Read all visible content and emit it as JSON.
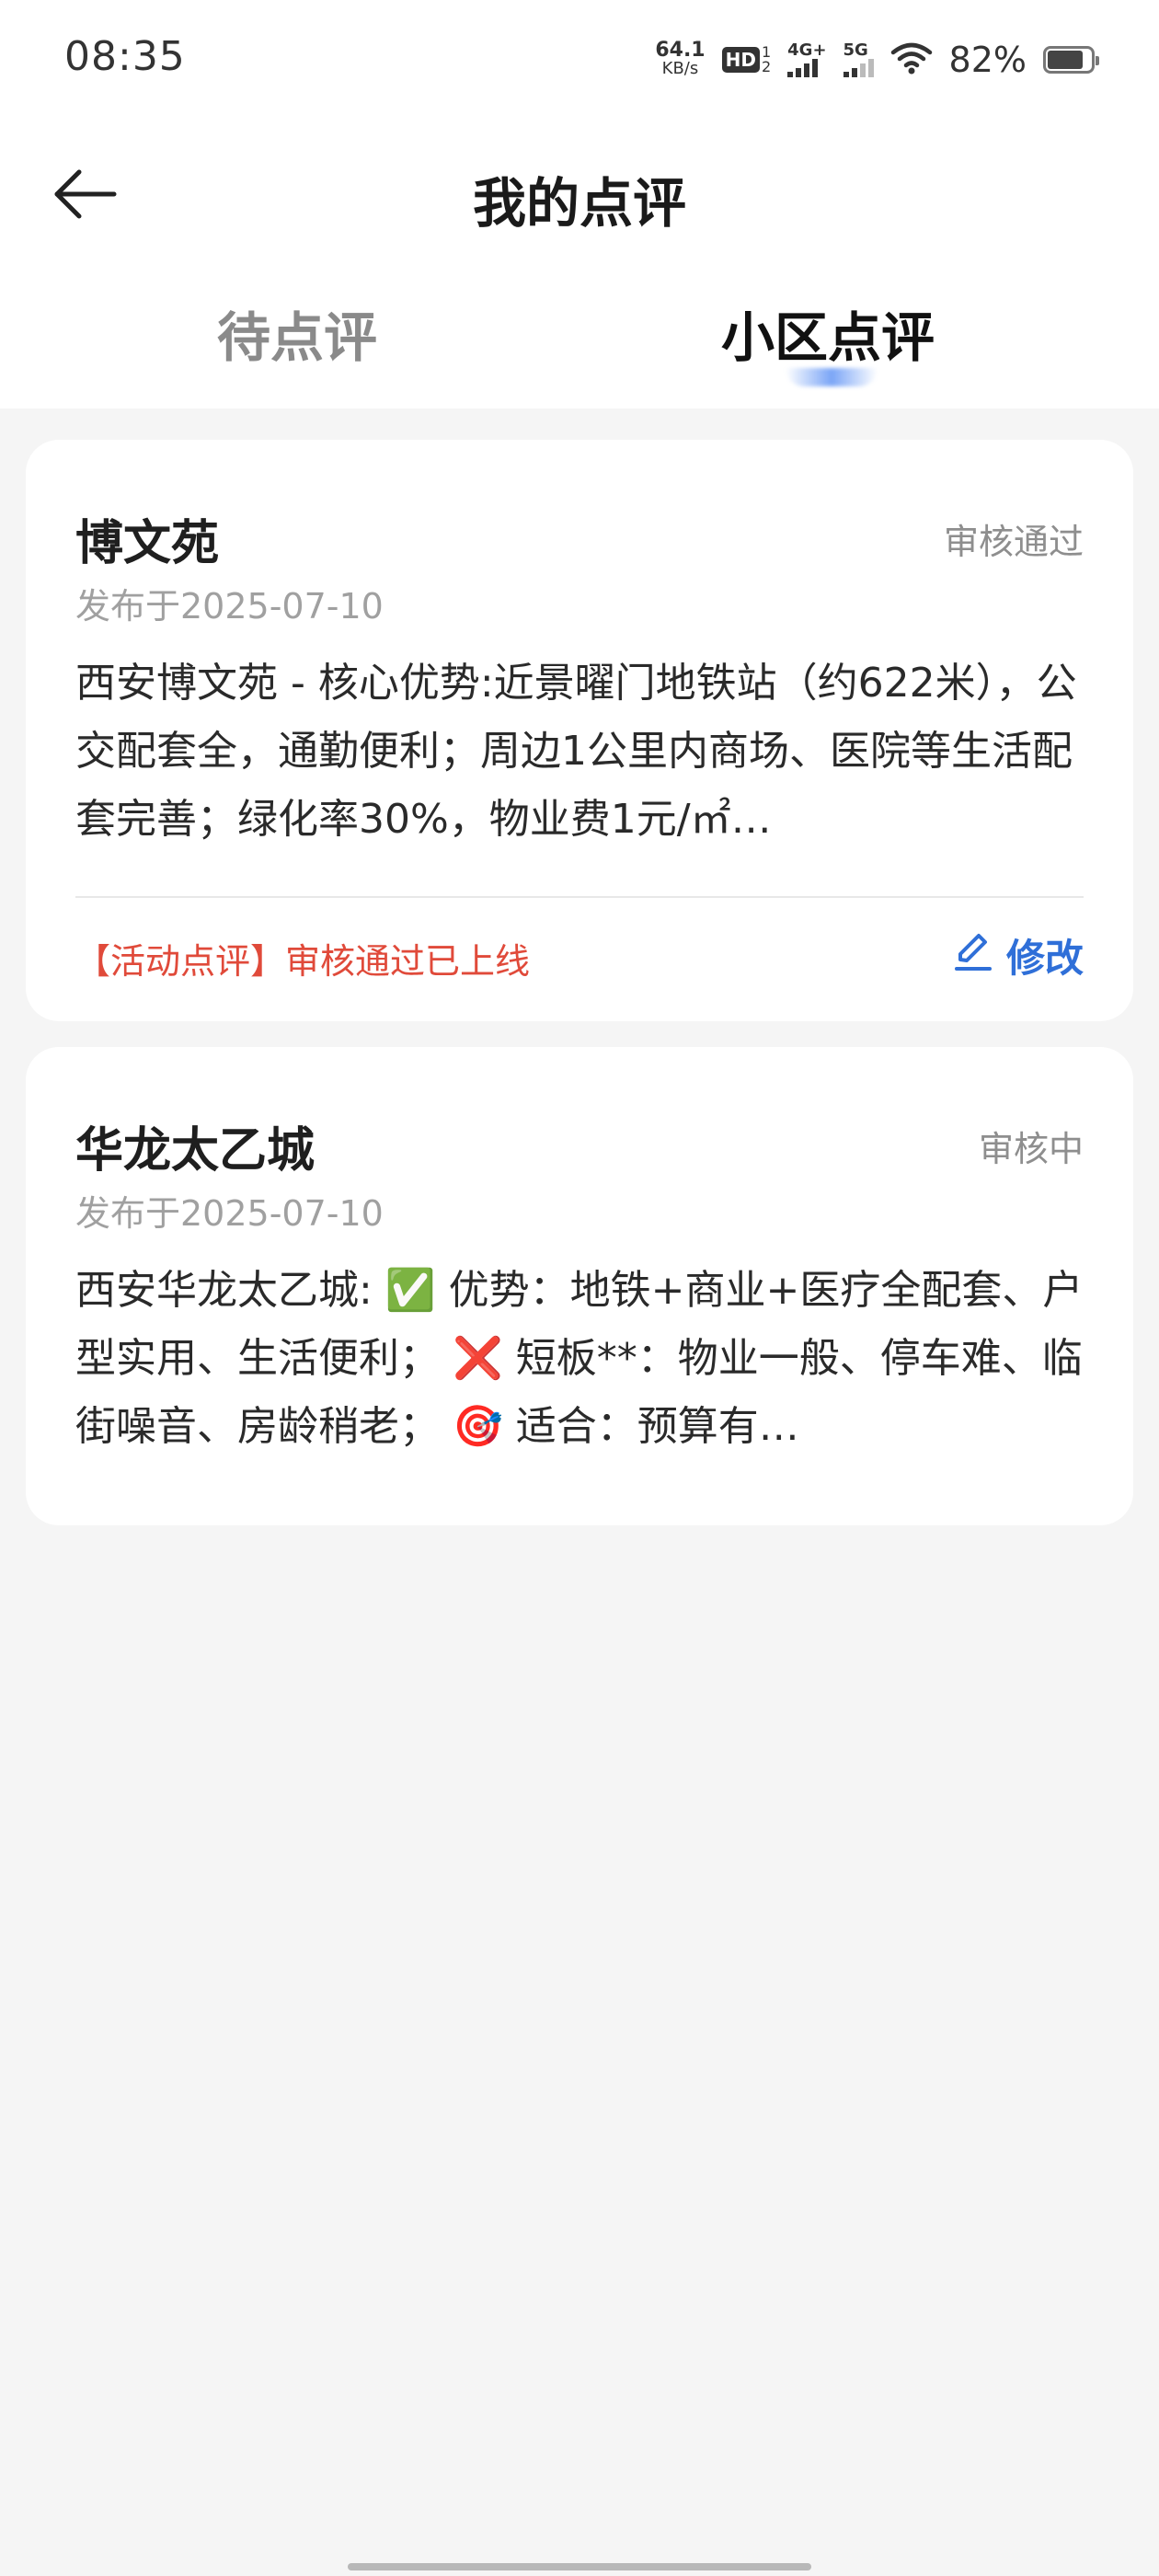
{
  "status_bar": {
    "time": "08:35",
    "net_speed_value": "64.1",
    "net_speed_unit": "KB/s",
    "hd_label": "HD",
    "hd_sub_top": "1",
    "hd_sub_bottom": "2",
    "signal_1_label": "4G+",
    "signal_2_label": "5G",
    "battery_percent": "82%",
    "battery_level": 0.82,
    "icons": [
      "network-speed-icon",
      "hd-call-icon",
      "signal-4g-icon",
      "signal-5g-icon",
      "wifi-icon",
      "battery-icon"
    ]
  },
  "header": {
    "title": "我的点评",
    "back_icon": "arrow-left-icon"
  },
  "tabs": [
    {
      "label": "待点评",
      "active": false
    },
    {
      "label": "小区点评",
      "active": true
    }
  ],
  "reviews": [
    {
      "title": "博文苑",
      "status": "审核通过",
      "date": "发布于2025-07-10",
      "content": "西安博文苑 - 核心优势:近景曜门地铁站（约622米），公交配套全，通勤便利；周边1公里内商场、医院等生活配套完善；绿化率30%，物业费1元/㎡…",
      "footer_note": "【活动点评】审核通过已上线",
      "edit_label": "修改",
      "edit_icon": "pencil-icon"
    },
    {
      "title": "华龙太乙城",
      "status": "审核中",
      "date": "发布于2025-07-10",
      "content": "西安华龙太乙城: ✅ 优势：地铁+商业+医疗全配套、户型实用、生活便利；   ❌ 短板**：物业一般、停车难、临街噪音、房龄稍老；   🎯 适合：预算有…"
    }
  ],
  "colors": {
    "accent_blue": "#2f6fd8",
    "highlight_red": "#e04a3a",
    "background": "#f5f5f5"
  }
}
